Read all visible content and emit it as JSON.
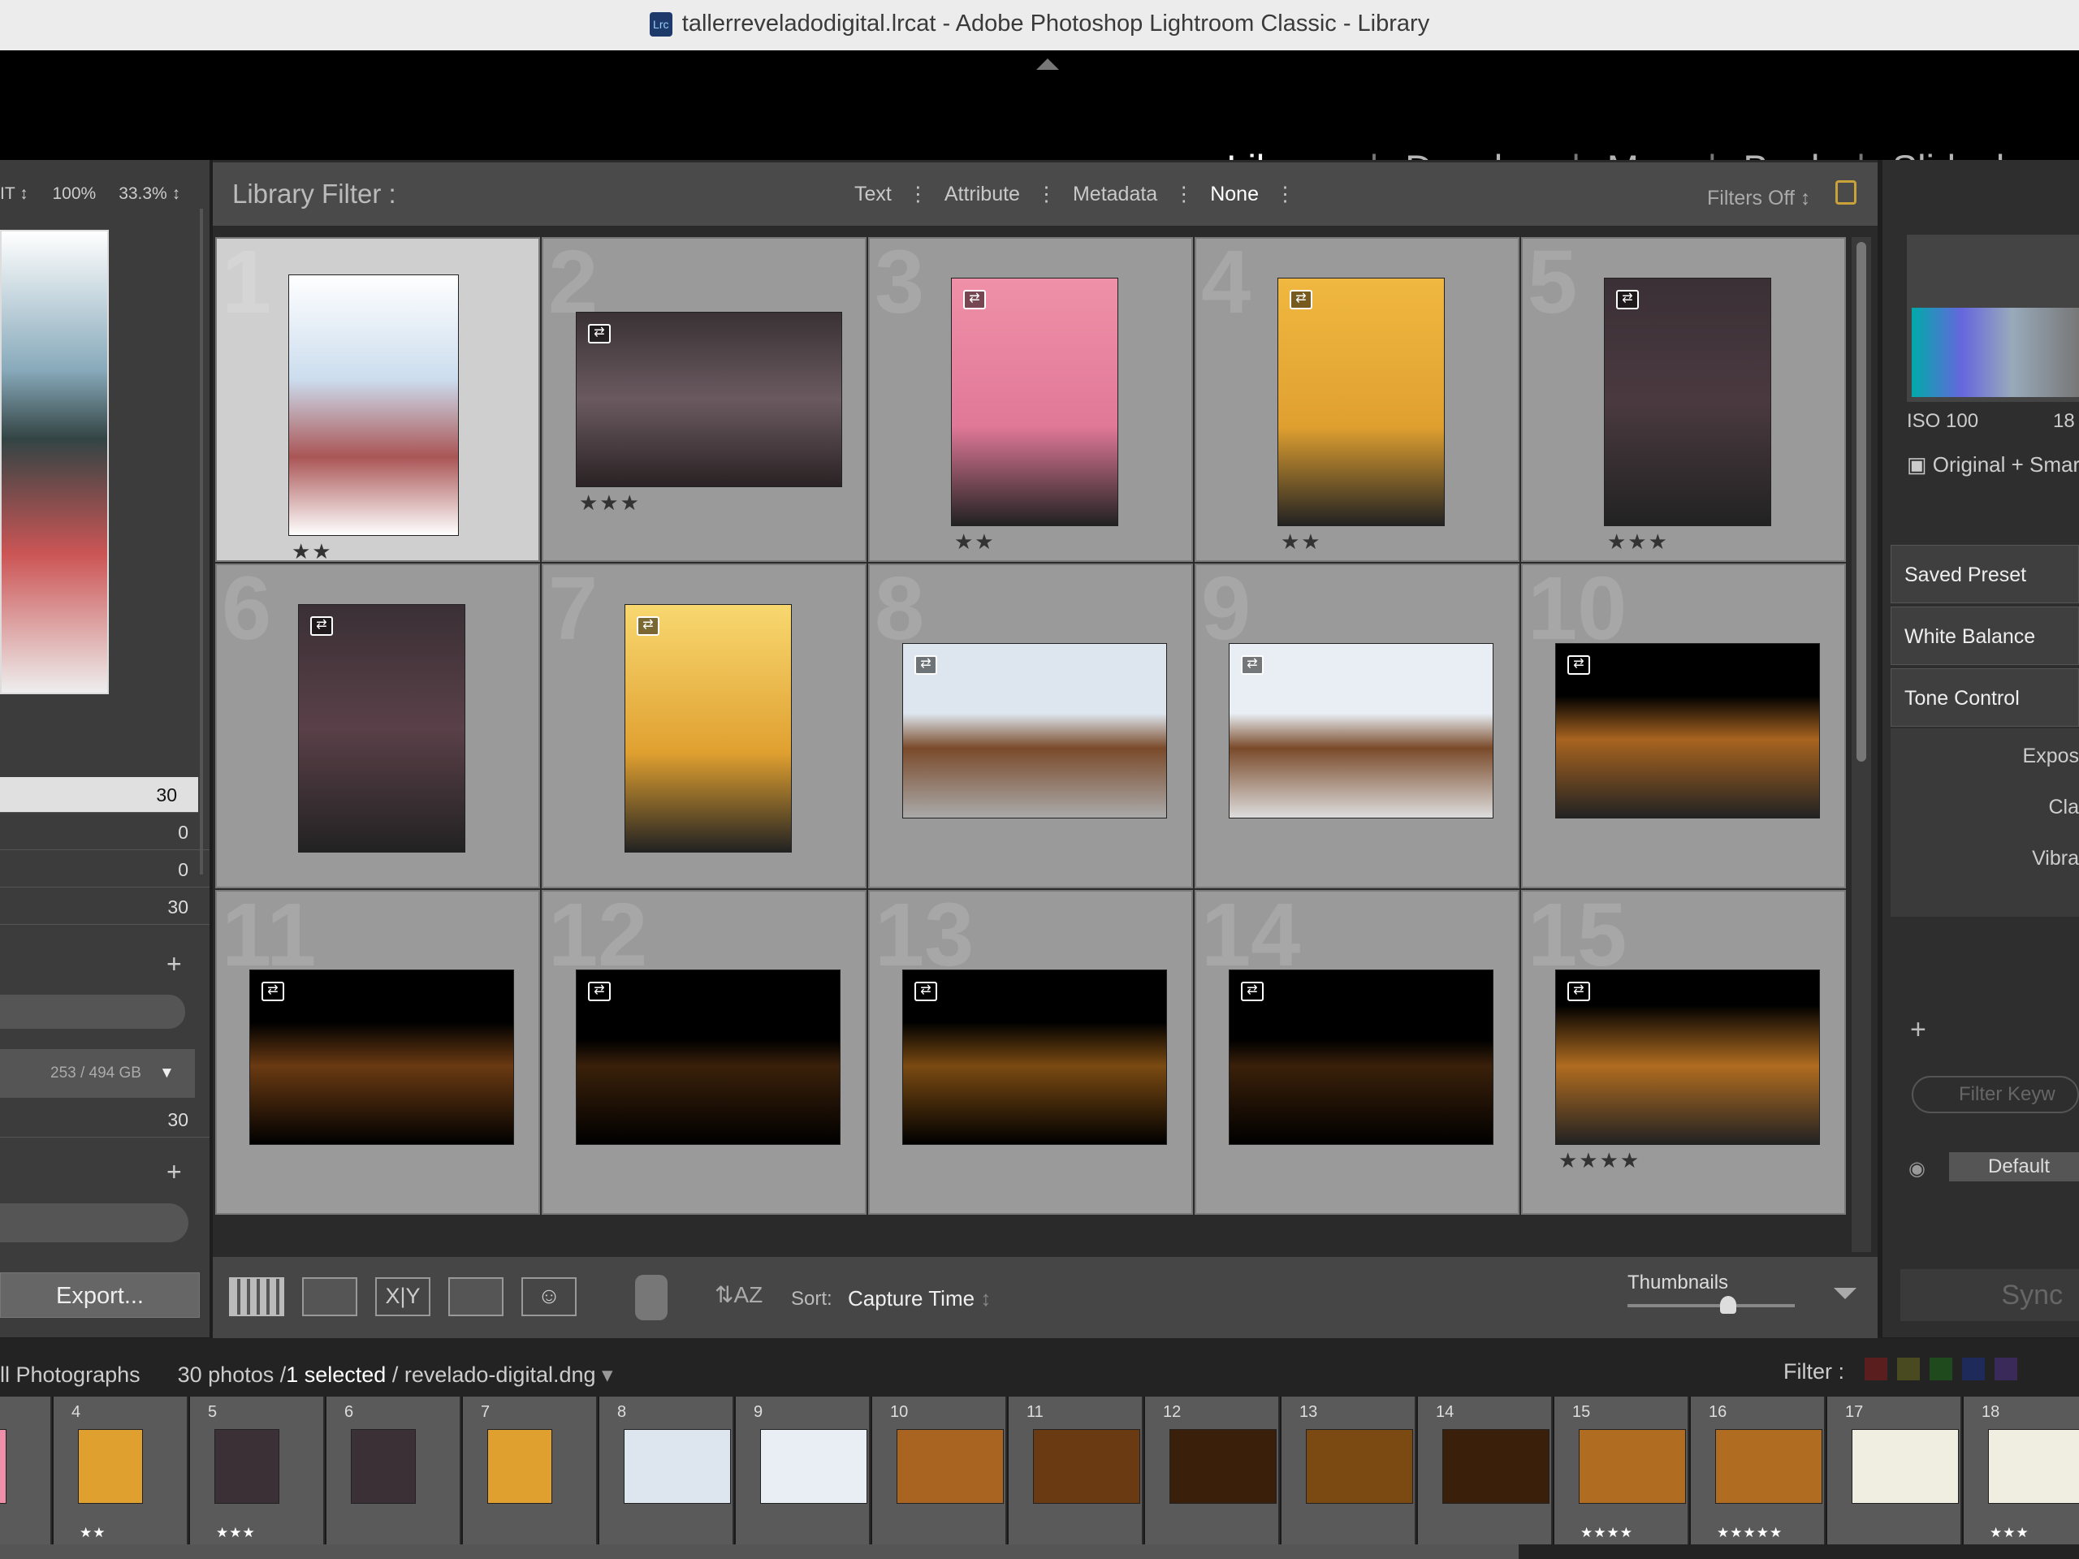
{
  "window": {
    "title": "tallerreveladodigital.lrcat - Adobe Photoshop Lightroom Classic - Library",
    "icon": "Lrc"
  },
  "modules": [
    {
      "label": "Library",
      "active": true
    },
    {
      "label": "Develop"
    },
    {
      "label": "Map"
    },
    {
      "label": "Book"
    },
    {
      "label": "Slideshow"
    }
  ],
  "left": {
    "zoom": [
      "IT",
      "100%",
      "33.3%"
    ],
    "values": [
      "30",
      "0",
      "0",
      "30"
    ],
    "disk": "253 / 494 GB",
    "count": "30",
    "export": "Export..."
  },
  "filter": {
    "title": "Library Filter :",
    "options": [
      "Text",
      "Attribute",
      "Metadata",
      "None"
    ],
    "status": "Filters Off"
  },
  "photos": [
    {
      "n": "1",
      "s": "★★"
    },
    {
      "n": "2",
      "s": "★★★"
    },
    {
      "n": "3",
      "s": "★★"
    },
    {
      "n": "4",
      "s": "★★"
    },
    {
      "n": "5",
      "s": "★★★"
    },
    {
      "n": "6",
      "s": ""
    },
    {
      "n": "7",
      "s": ""
    },
    {
      "n": "8",
      "s": ""
    },
    {
      "n": "9",
      "s": ""
    },
    {
      "n": "10",
      "s": ""
    },
    {
      "n": "11",
      "s": ""
    },
    {
      "n": "12",
      "s": ""
    },
    {
      "n": "13",
      "s": ""
    },
    {
      "n": "14",
      "s": ""
    },
    {
      "n": "15",
      "s": "★★★★"
    }
  ],
  "toolbar": {
    "sort_label": "Sort:",
    "sort_value": "Capture Time",
    "thumbnails": "Thumbnails",
    "thumb_size": 0.6
  },
  "right": {
    "iso": "ISO 100",
    "focal": "18",
    "original": "Original + Smart",
    "panels": [
      "Saved Preset",
      "White Balance",
      "Tone Control"
    ],
    "sliders": [
      "Expos",
      "Cla",
      "Vibra"
    ],
    "keyword_placeholder": "Filter Keyw",
    "preset": "Default",
    "sync": "Sync"
  },
  "status": {
    "source": "ll Photographs",
    "count": "30 photos /",
    "selected": "1 selected",
    "file": "/ revelado-digital.dng",
    "filter_label": "Filter :"
  },
  "filmstrip": [
    {
      "n": "",
      "s": ""
    },
    {
      "n": "4",
      "s": "★★"
    },
    {
      "n": "5",
      "s": "★★★"
    },
    {
      "n": "6",
      "s": ""
    },
    {
      "n": "7",
      "s": ""
    },
    {
      "n": "8",
      "s": ""
    },
    {
      "n": "9",
      "s": ""
    },
    {
      "n": "10",
      "s": ""
    },
    {
      "n": "11",
      "s": ""
    },
    {
      "n": "12",
      "s": ""
    },
    {
      "n": "13",
      "s": ""
    },
    {
      "n": "14",
      "s": ""
    },
    {
      "n": "15",
      "s": "★★★★"
    },
    {
      "n": "16",
      "s": "★★★★★"
    },
    {
      "n": "17",
      "s": ""
    },
    {
      "n": "18",
      "s": "★★★"
    }
  ],
  "colors": {
    "accent": "#ffffff",
    "label_red": "#5a1e1e",
    "label_yellow": "#4a4a20",
    "label_green": "#1e4a1e",
    "label_blue": "#1e2a5a",
    "label_purple": "#3a2a5a"
  }
}
